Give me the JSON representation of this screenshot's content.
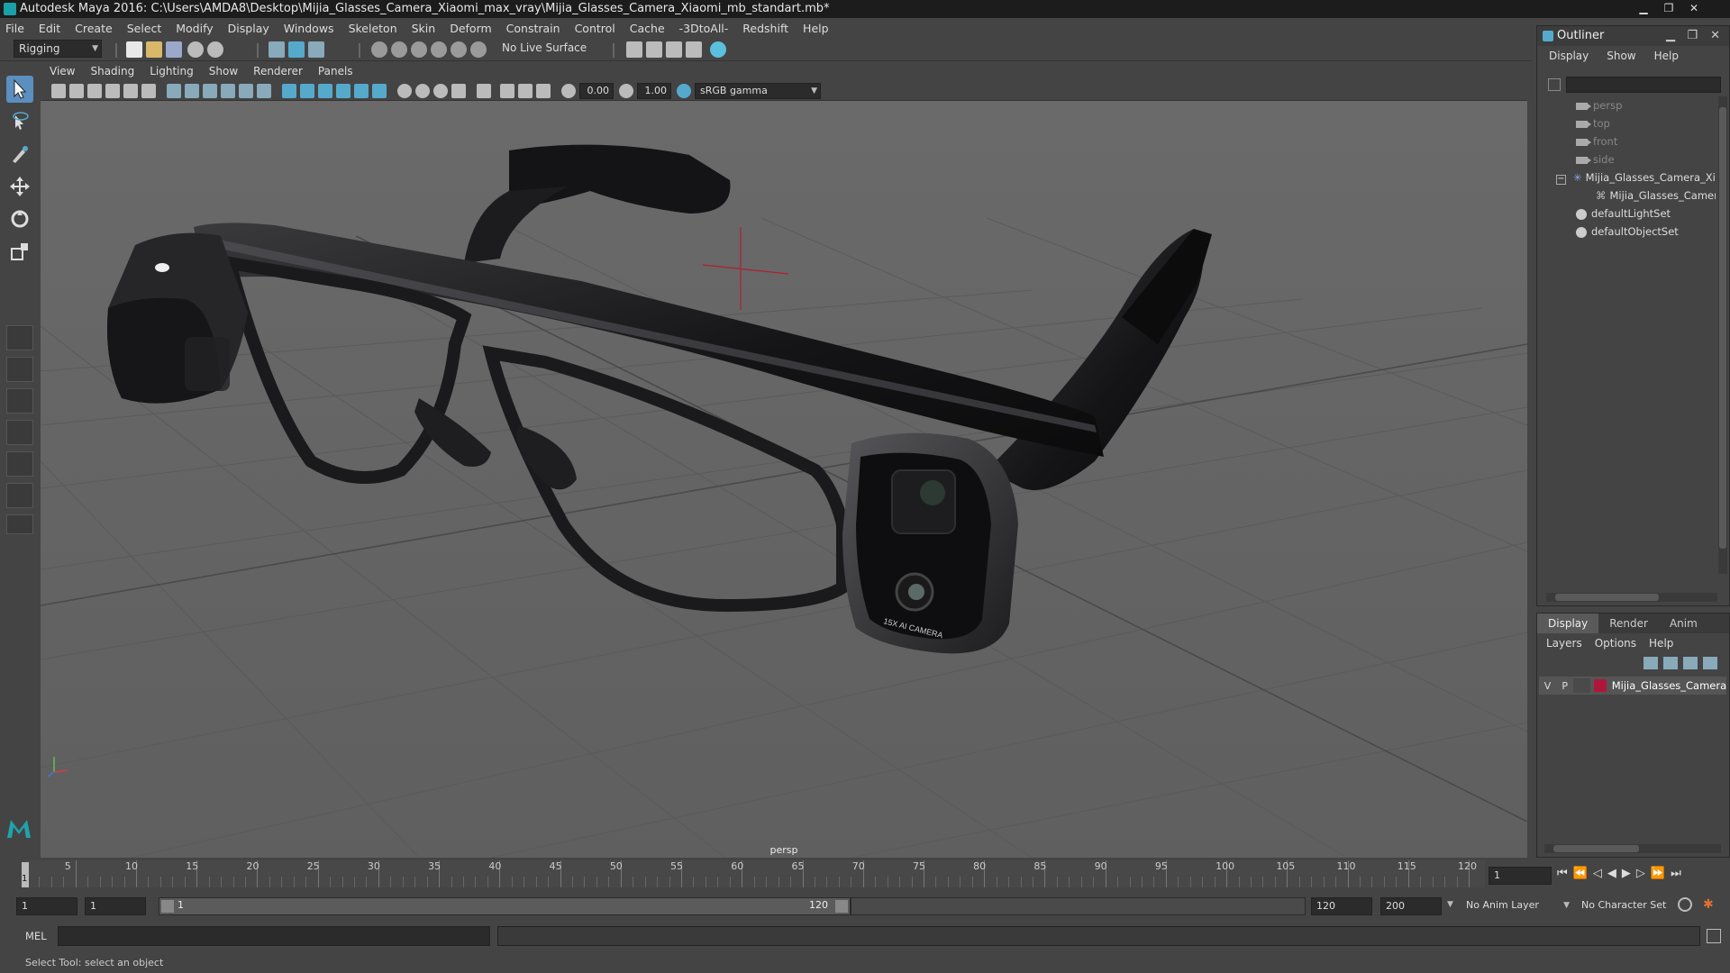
{
  "window": {
    "title": "Autodesk Maya 2016: C:\\Users\\AMDA8\\Desktop\\Mijia_Glasses_Camera_Xiaomi_max_vray\\Mijia_Glasses_Camera_Xiaomi_mb_standart.mb*"
  },
  "menubar": [
    "File",
    "Edit",
    "Create",
    "Select",
    "Modify",
    "Display",
    "Windows",
    "Skeleton",
    "Skin",
    "Deform",
    "Constrain",
    "Control",
    "Cache",
    "-3DtoAll-",
    "Redshift",
    "Help"
  ],
  "shelf": {
    "mode": "Rigging",
    "live_surface": "No Live Surface"
  },
  "viewport": {
    "menu": [
      "View",
      "Shading",
      "Lighting",
      "Show",
      "Renderer",
      "Panels"
    ],
    "exposure": "0.00",
    "gamma": "1.00",
    "color_space": "sRGB gamma",
    "camera_label": "persp",
    "model_text": "15X AI CAMERA"
  },
  "outliner": {
    "title": "Outliner",
    "menu": [
      "Display",
      "Show",
      "Help"
    ],
    "items": [
      "persp",
      "top",
      "front",
      "side",
      "Mijia_Glasses_Camera_Xi",
      "Mijia_Glasses_Camer",
      "defaultLightSet",
      "defaultObjectSet"
    ]
  },
  "layers": {
    "tabs": [
      "Display",
      "Render",
      "Anim"
    ],
    "menu": [
      "Layers",
      "Options",
      "Help"
    ],
    "row": {
      "v": "V",
      "p": "P",
      "name": "Mijia_Glasses_Camera_",
      "color": "#b0163a"
    }
  },
  "timeline": {
    "labels": [
      "5",
      "10",
      "15",
      "20",
      "25",
      "30",
      "35",
      "40",
      "45",
      "50",
      "55",
      "60",
      "65",
      "70",
      "75",
      "80",
      "85",
      "90",
      "95",
      "100",
      "105",
      "110",
      "115",
      "120"
    ],
    "current_frame_marker": "1",
    "current_frame_field": "1"
  },
  "range": {
    "start": "1",
    "start2": "1",
    "slider_start": "1",
    "slider_end": "120",
    "end": "120",
    "end2": "200",
    "anim_layer": "No Anim Layer",
    "character_set": "No Character Set"
  },
  "cmdline": {
    "label": "MEL"
  },
  "helpline": {
    "text": "Select Tool: select an object"
  }
}
